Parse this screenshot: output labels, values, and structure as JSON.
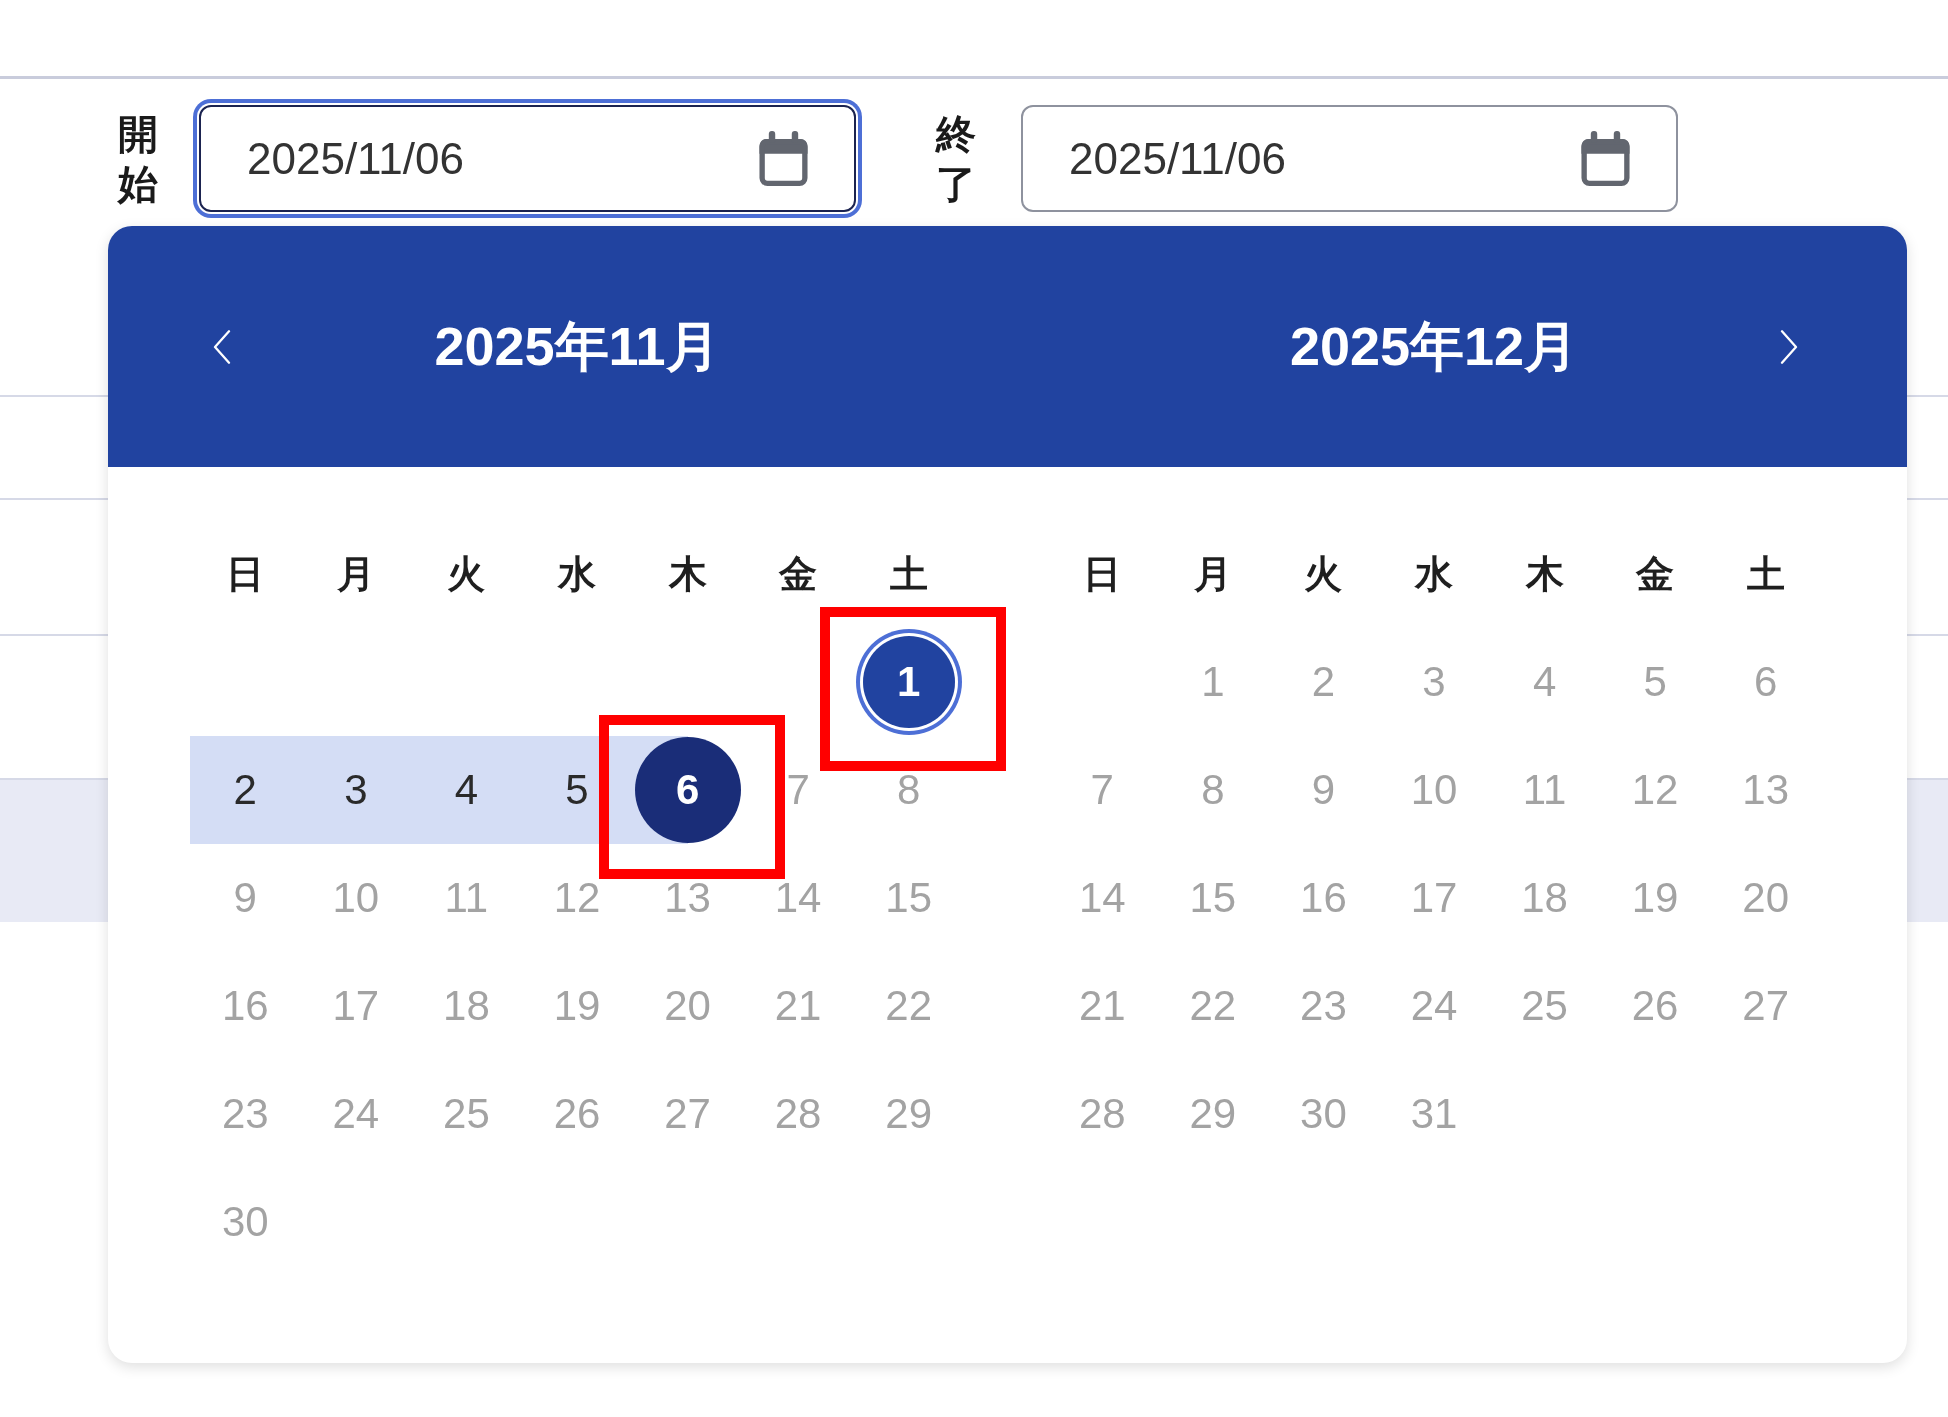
{
  "filters": [
    {
      "label": "開始",
      "value": "2025/11/06",
      "focused": true
    },
    {
      "label": "終了",
      "value": "2025/11/06",
      "focused": false
    }
  ],
  "background_table": {
    "rows": [
      {
        "selected": false
      },
      {
        "selected": false
      },
      {
        "selected": false
      },
      {
        "selected": true
      }
    ]
  },
  "date_picker": {
    "months": [
      {
        "title": "2025年11月",
        "weekdays": [
          "日",
          "月",
          "火",
          "水",
          "木",
          "金",
          "土"
        ],
        "weeks": [
          {
            "days": [
              {
                "label": "1",
                "disabled": false,
                "in_range": false,
                "selected": true,
                "focused": true,
                "annotated": true
              }
            ]
          },
          {
            "days": [
              {
                "label": "2",
                "disabled": false,
                "in_range": true,
                "selected": false,
                "focused": false,
                "annotated": false
              },
              {
                "label": "3",
                "disabled": false,
                "in_range": true,
                "selected": false,
                "focused": false,
                "annotated": false
              },
              {
                "label": "4",
                "disabled": false,
                "in_range": true,
                "selected": false,
                "focused": false,
                "annotated": false
              },
              {
                "label": "5",
                "disabled": false,
                "in_range": true,
                "selected": false,
                "focused": false,
                "annotated": false
              },
              {
                "label": "6",
                "disabled": false,
                "in_range": true,
                "selected": true,
                "focused": false,
                "annotated": true
              },
              {
                "label": "7",
                "disabled": true,
                "in_range": false,
                "selected": false,
                "focused": false,
                "annotated": false
              },
              {
                "label": "8",
                "disabled": true,
                "in_range": false,
                "selected": false,
                "focused": false,
                "annotated": false
              }
            ]
          },
          {
            "days": [
              {
                "label": "9",
                "disabled": true,
                "in_range": false,
                "selected": false,
                "focused": false,
                "annotated": false
              },
              {
                "label": "10",
                "disabled": true,
                "in_range": false,
                "selected": false,
                "focused": false,
                "annotated": false
              },
              {
                "label": "11",
                "disabled": true,
                "in_range": false,
                "selected": false,
                "focused": false,
                "annotated": false
              },
              {
                "label": "12",
                "disabled": true,
                "in_range": false,
                "selected": false,
                "focused": false,
                "annotated": false
              },
              {
                "label": "13",
                "disabled": true,
                "in_range": false,
                "selected": false,
                "focused": false,
                "annotated": false
              },
              {
                "label": "14",
                "disabled": true,
                "in_range": false,
                "selected": false,
                "focused": false,
                "annotated": false
              },
              {
                "label": "15",
                "disabled": true,
                "in_range": false,
                "selected": false,
                "focused": false,
                "annotated": false
              }
            ]
          },
          {
            "days": [
              {
                "label": "16",
                "disabled": true,
                "in_range": false,
                "selected": false,
                "focused": false,
                "annotated": false
              },
              {
                "label": "17",
                "disabled": true,
                "in_range": false,
                "selected": false,
                "focused": false,
                "annotated": false
              },
              {
                "label": "18",
                "disabled": true,
                "in_range": false,
                "selected": false,
                "focused": false,
                "annotated": false
              },
              {
                "label": "19",
                "disabled": true,
                "in_range": false,
                "selected": false,
                "focused": false,
                "annotated": false
              },
              {
                "label": "20",
                "disabled": true,
                "in_range": false,
                "selected": false,
                "focused": false,
                "annotated": false
              },
              {
                "label": "21",
                "disabled": true,
                "in_range": false,
                "selected": false,
                "focused": false,
                "annotated": false
              },
              {
                "label": "22",
                "disabled": true,
                "in_range": false,
                "selected": false,
                "focused": false,
                "annotated": false
              }
            ]
          },
          {
            "days": [
              {
                "label": "23",
                "disabled": true,
                "in_range": false,
                "selected": false,
                "focused": false,
                "annotated": false
              },
              {
                "label": "24",
                "disabled": true,
                "in_range": false,
                "selected": false,
                "focused": false,
                "annotated": false
              },
              {
                "label": "25",
                "disabled": true,
                "in_range": false,
                "selected": false,
                "focused": false,
                "annotated": false
              },
              {
                "label": "26",
                "disabled": true,
                "in_range": false,
                "selected": false,
                "focused": false,
                "annotated": false
              },
              {
                "label": "27",
                "disabled": true,
                "in_range": false,
                "selected": false,
                "focused": false,
                "annotated": false
              },
              {
                "label": "28",
                "disabled": true,
                "in_range": false,
                "selected": false,
                "focused": false,
                "annotated": false
              },
              {
                "label": "29",
                "disabled": true,
                "in_range": false,
                "selected": false,
                "focused": false,
                "annotated": false
              }
            ]
          },
          {
            "days": [
              {
                "label": "30",
                "disabled": true,
                "in_range": false,
                "selected": false,
                "focused": false,
                "annotated": false
              }
            ]
          }
        ]
      },
      {
        "title": "2025年12月",
        "weekdays": [
          "日",
          "月",
          "火",
          "水",
          "木",
          "金",
          "土"
        ],
        "weeks": [
          {
            "days": [
              {
                "label": "1",
                "disabled": true,
                "in_range": false,
                "selected": false,
                "focused": false,
                "annotated": false
              },
              {
                "label": "2",
                "disabled": true,
                "in_range": false,
                "selected": false,
                "focused": false,
                "annotated": false
              },
              {
                "label": "3",
                "disabled": true,
                "in_range": false,
                "selected": false,
                "focused": false,
                "annotated": false
              },
              {
                "label": "4",
                "disabled": true,
                "in_range": false,
                "selected": false,
                "focused": false,
                "annotated": false
              },
              {
                "label": "5",
                "disabled": true,
                "in_range": false,
                "selected": false,
                "focused": false,
                "annotated": false
              },
              {
                "label": "6",
                "disabled": true,
                "in_range": false,
                "selected": false,
                "focused": false,
                "annotated": false
              }
            ]
          },
          {
            "days": [
              {
                "label": "7",
                "disabled": true,
                "in_range": false,
                "selected": false,
                "focused": false,
                "annotated": false
              },
              {
                "label": "8",
                "disabled": true,
                "in_range": false,
                "selected": false,
                "focused": false,
                "annotated": false
              },
              {
                "label": "9",
                "disabled": true,
                "in_range": false,
                "selected": false,
                "focused": false,
                "annotated": false
              },
              {
                "label": "10",
                "disabled": true,
                "in_range": false,
                "selected": false,
                "focused": false,
                "annotated": false
              },
              {
                "label": "11",
                "disabled": true,
                "in_range": false,
                "selected": false,
                "focused": false,
                "annotated": false
              },
              {
                "label": "12",
                "disabled": true,
                "in_range": false,
                "selected": false,
                "focused": false,
                "annotated": false
              },
              {
                "label": "13",
                "disabled": true,
                "in_range": false,
                "selected": false,
                "focused": false,
                "annotated": false
              }
            ]
          },
          {
            "days": [
              {
                "label": "14",
                "disabled": true,
                "in_range": false,
                "selected": false,
                "focused": false,
                "annotated": false
              },
              {
                "label": "15",
                "disabled": true,
                "in_range": false,
                "selected": false,
                "focused": false,
                "annotated": false
              },
              {
                "label": "16",
                "disabled": true,
                "in_range": false,
                "selected": false,
                "focused": false,
                "annotated": false
              },
              {
                "label": "17",
                "disabled": true,
                "in_range": false,
                "selected": false,
                "focused": false,
                "annotated": false
              },
              {
                "label": "18",
                "disabled": true,
                "in_range": false,
                "selected": false,
                "focused": false,
                "annotated": false
              },
              {
                "label": "19",
                "disabled": true,
                "in_range": false,
                "selected": false,
                "focused": false,
                "annotated": false
              },
              {
                "label": "20",
                "disabled": true,
                "in_range": false,
                "selected": false,
                "focused": false,
                "annotated": false
              }
            ]
          },
          {
            "days": [
              {
                "label": "21",
                "disabled": true,
                "in_range": false,
                "selected": false,
                "focused": false,
                "annotated": false
              },
              {
                "label": "22",
                "disabled": true,
                "in_range": false,
                "selected": false,
                "focused": false,
                "annotated": false
              },
              {
                "label": "23",
                "disabled": true,
                "in_range": false,
                "selected": false,
                "focused": false,
                "annotated": false
              },
              {
                "label": "24",
                "disabled": true,
                "in_range": false,
                "selected": false,
                "focused": false,
                "annotated": false
              },
              {
                "label": "25",
                "disabled": true,
                "in_range": false,
                "selected": false,
                "focused": false,
                "annotated": false
              },
              {
                "label": "26",
                "disabled": true,
                "in_range": false,
                "selected": false,
                "focused": false,
                "annotated": false
              },
              {
                "label": "27",
                "disabled": true,
                "in_range": false,
                "selected": false,
                "focused": false,
                "annotated": false
              }
            ]
          },
          {
            "days": [
              {
                "label": "28",
                "disabled": true,
                "in_range": false,
                "selected": false,
                "focused": false,
                "annotated": false
              },
              {
                "label": "29",
                "disabled": true,
                "in_range": false,
                "selected": false,
                "focused": false,
                "annotated": false
              },
              {
                "label": "30",
                "disabled": true,
                "in_range": false,
                "selected": false,
                "focused": false,
                "annotated": false
              },
              {
                "label": "31",
                "disabled": true,
                "in_range": false,
                "selected": false,
                "focused": false,
                "annotated": false
              }
            ]
          }
        ]
      }
    ]
  }
}
